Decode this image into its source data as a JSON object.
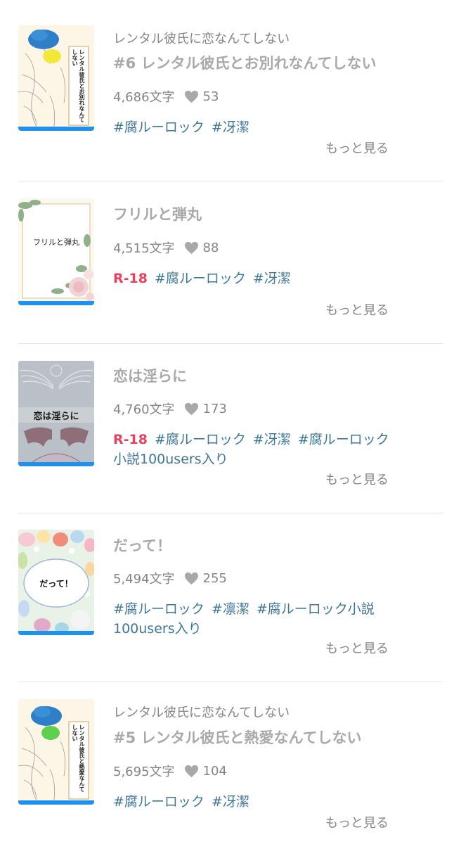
{
  "items": [
    {
      "series": "レンタル彼氏に恋なんてしない",
      "title": "#6 レンタル彼氏とお別れなんてしない",
      "chars": "4,686文字",
      "likes": "53",
      "r18": "",
      "tags": [
        "#腐ルーロック",
        "#冴潔"
      ],
      "more": "もっと見る",
      "cover_text": "レンタル彼氏とお別れなんてしない",
      "cover_style": "flower-blue-yellow"
    },
    {
      "series": "",
      "title": "フリルと弾丸",
      "chars": "4,515文字",
      "likes": "88",
      "r18": "R-18",
      "tags": [
        "#腐ルーロック",
        "#冴潔"
      ],
      "more": "もっと見る",
      "cover_text": "フリルと弾丸",
      "cover_style": "floral-frame"
    },
    {
      "series": "",
      "title": "恋は淫らに",
      "chars": "4,760文字",
      "likes": "173",
      "r18": "R-18",
      "tags": [
        "#腐ルーロック",
        "#冴潔",
        "#腐ルーロック",
        "小説100users入り"
      ],
      "more": "もっと見る",
      "cover_text": "恋は淫らに",
      "cover_style": "wings"
    },
    {
      "series": "",
      "title": "だって！",
      "chars": "5,494文字",
      "likes": "255",
      "r18": "",
      "tags": [
        "#腐ルーロック",
        "#凛潔",
        "#腐ルーロック小説",
        "100users入り"
      ],
      "more": "もっと見る",
      "cover_text": "だって！",
      "cover_style": "easter"
    },
    {
      "series": "レンタル彼氏に恋なんてしない",
      "title": "#5 レンタル彼氏と熱愛なんてしない",
      "chars": "5,695文字",
      "likes": "104",
      "r18": "",
      "tags": [
        "#腐ルーロック",
        "#冴潔"
      ],
      "more": "もっと見る",
      "cover_text": "レンタル彼氏と熱愛なんてしない",
      "cover_style": "flower-blue-green"
    }
  ],
  "colors": {
    "accent_bar": "#1e90f0",
    "tag": "#3d7699",
    "r18": "#e8435e"
  }
}
